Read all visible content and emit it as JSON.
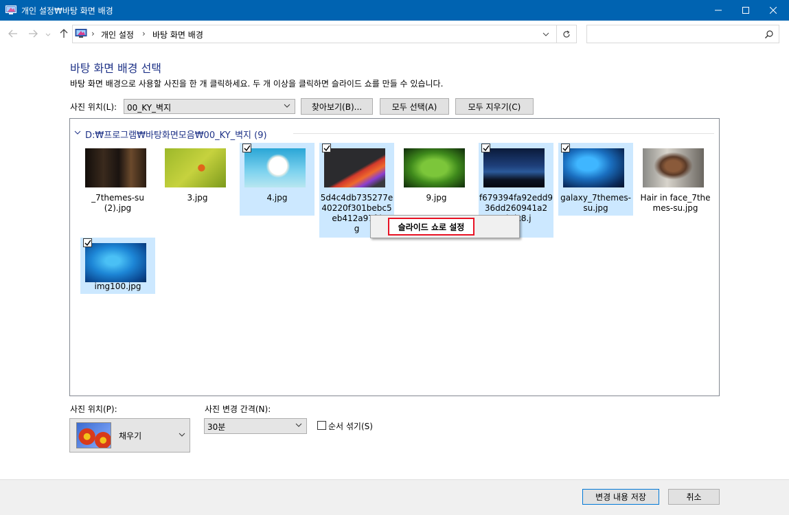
{
  "window": {
    "title": "개인 설정₩바탕 화면 배경",
    "icon": "personalization-icon"
  },
  "address": {
    "crumbs": [
      "개인 설정",
      "바탕 화면 배경"
    ],
    "search_placeholder": ""
  },
  "page": {
    "heading": "바탕 화면 배경 선택",
    "description": "바탕 화면 배경으로 사용할 사진을 한 개 클릭하세요. 두 개 이상을 클릭하면 슬라이드 쇼를 만들 수 있습니다."
  },
  "picture_location": {
    "label": "사진 위치(L):",
    "value": "00_KY_벽지",
    "browse": "찾아보기(B)...",
    "select_all": "모두 선택(A)",
    "clear_all": "모두 지우기(C)"
  },
  "group": {
    "header": "D:₩프로그램₩바탕화면모음₩00_KY_벽지 (9)"
  },
  "items": [
    {
      "name": "_7themes-su\n(2).jpg",
      "selected": false,
      "checked": false
    },
    {
      "name": "3.jpg",
      "selected": false,
      "checked": false
    },
    {
      "name": "4.jpg",
      "selected": true,
      "checked": true
    },
    {
      "name": "5d4c4db735277e40220f301bebc5eb412a97fd\ng",
      "selected": true,
      "checked": true
    },
    {
      "name": "9.jpg",
      "selected": false,
      "checked": false
    },
    {
      "name": "f679394fa92edd936dd260941a2\n0bdc8.j",
      "selected": true,
      "checked": true
    },
    {
      "name": "galaxy_7themes-su.jpg",
      "selected": true,
      "checked": true
    },
    {
      "name": "Hair in face_7themes-su.jpg",
      "selected": false,
      "checked": false
    },
    {
      "name": "img100.jpg",
      "selected": true,
      "checked": true
    }
  ],
  "context_menu": {
    "item": "슬라이드 쇼로 설정"
  },
  "position": {
    "label": "사진 위치(P):",
    "value": "채우기"
  },
  "interval": {
    "label": "사진 변경 간격(N):",
    "value": "30분"
  },
  "shuffle": {
    "label": "순서 섞기(S)",
    "checked": false
  },
  "footer": {
    "save": "변경 내용 저장",
    "cancel": "취소"
  },
  "colors": {
    "titlebar": "#0063b1",
    "heading": "#1e3287",
    "selection": "#cce8ff",
    "highlight_border": "#e81123"
  }
}
